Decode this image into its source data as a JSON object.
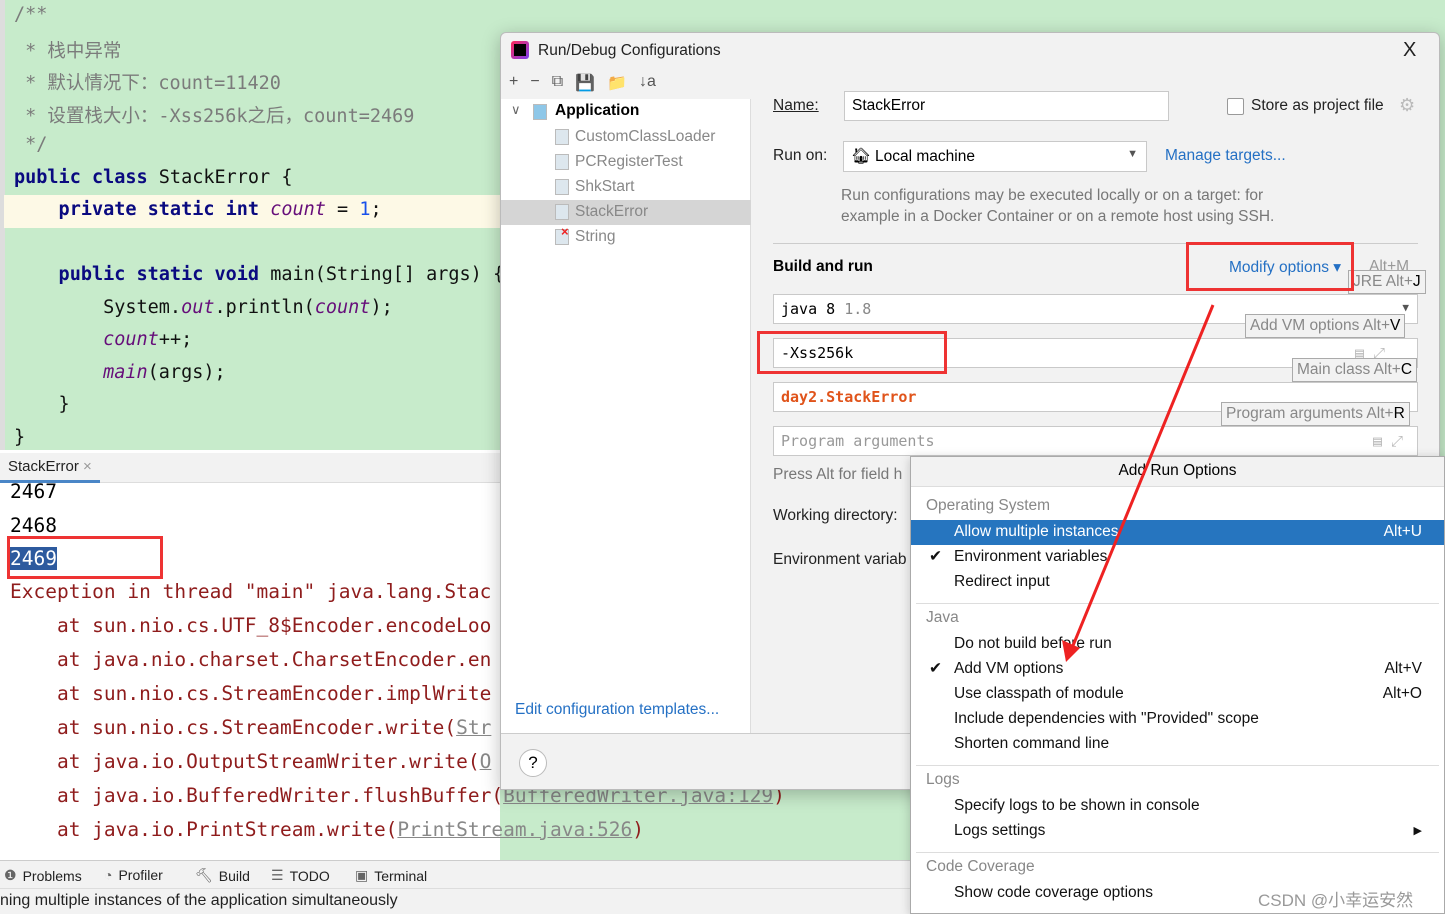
{
  "editor": {
    "lines": [
      {
        "parts": [
          {
            "t": "/**",
            "c": "cm"
          }
        ]
      },
      {
        "parts": [
          {
            "t": " * 栈中异常",
            "c": "cm"
          }
        ]
      },
      {
        "parts": [
          {
            "t": " * 默认情况下：count=11420",
            "c": "cm"
          }
        ]
      },
      {
        "parts": [
          {
            "t": " * 设置栈大小：-Xss256k之后，count=2469",
            "c": "cm"
          }
        ]
      },
      {
        "parts": [
          {
            "t": " */",
            "c": "cm"
          }
        ]
      },
      {
        "parts": [
          {
            "t": "public class ",
            "c": "kw"
          },
          {
            "t": "StackError {",
            "c": ""
          }
        ]
      },
      {
        "parts": [
          {
            "t": "    private static int ",
            "c": "kw"
          },
          {
            "t": "count",
            "c": "fld"
          },
          {
            "t": " = ",
            "c": ""
          },
          {
            "t": "1",
            "c": "num"
          },
          {
            "t": ";",
            "c": ""
          }
        ]
      },
      {
        "parts": []
      },
      {
        "parts": [
          {
            "t": "    public static void ",
            "c": "kw"
          },
          {
            "t": "main(String[] args) {",
            "c": ""
          }
        ]
      },
      {
        "parts": [
          {
            "t": "        System.",
            "c": ""
          },
          {
            "t": "out",
            "c": "fld"
          },
          {
            "t": ".println(",
            "c": ""
          },
          {
            "t": "count",
            "c": "fld"
          },
          {
            "t": ");",
            "c": ""
          }
        ]
      },
      {
        "parts": [
          {
            "t": "        ",
            "c": ""
          },
          {
            "t": "count",
            "c": "fld"
          },
          {
            "t": "++;",
            "c": ""
          }
        ]
      },
      {
        "parts": [
          {
            "t": "        ",
            "c": ""
          },
          {
            "t": "main",
            "c": "fld"
          },
          {
            "t": "(args);",
            "c": ""
          }
        ]
      },
      {
        "parts": [
          {
            "t": "    }",
            "c": ""
          }
        ]
      },
      {
        "parts": [
          {
            "t": "}",
            "c": ""
          }
        ]
      }
    ]
  },
  "run": {
    "tab": "StackError",
    "output": [
      "2467",
      "2468",
      "2469"
    ],
    "exception": "Exception in thread \"main\" java.lang.Stac",
    "trace": [
      {
        "text": "    at sun.nio.cs.UTF_8$Encoder.encodeLoo",
        "link": ""
      },
      {
        "text": "    at java.nio.charset.CharsetEncoder.en",
        "link": ""
      },
      {
        "text": "    at sun.nio.cs.StreamEncoder.implWrite",
        "link": ""
      },
      {
        "text": "    at sun.nio.cs.StreamEncoder.write(",
        "link": "Str"
      },
      {
        "text": "    at java.io.OutputStreamWriter.write(",
        "link": "O"
      },
      {
        "text": "    at java.io.BufferedWriter.flushBuffer(",
        "link": "BufferedWriter.java:129",
        "end": ")"
      },
      {
        "text": "    at java.io.PrintStream.write(",
        "link": "PrintStream.java:526",
        "end": ")"
      }
    ]
  },
  "bottom": {
    "tabs": [
      "Problems",
      "Profiler",
      "Build",
      "TODO",
      "Terminal"
    ],
    "status": "ning multiple instances of the application simultaneously"
  },
  "dialog": {
    "title": "Run/Debug Configurations",
    "close": "X",
    "toolbar": [
      "+",
      "−",
      "⧉",
      "💾",
      "📁",
      "↓a"
    ],
    "tree": {
      "group": "Application",
      "items": [
        "CustomClassLoader",
        "PCRegisterTest",
        "ShkStart",
        "StackError",
        "String"
      ]
    },
    "name_label": "Name:",
    "name_value": "StackError",
    "store_label": "Store as project file",
    "runon_label": "Run on:",
    "runon_value": "Local machine",
    "manage_targets": "Manage targets...",
    "hint": [
      "Run configurations may be executed locally or on a target: for",
      "example in a Docker Container or on a remote host using SSH."
    ],
    "build_run": "Build and run",
    "modify_options": "Modify options",
    "modify_shortcut": "Alt+M",
    "jre": "java 8",
    "jre_version": "1.8",
    "vm_options": "-Xss256k",
    "main_class": "day2.StackError",
    "program_args_placeholder": "Program arguments",
    "press_alt": "Press Alt for field h",
    "working_dir": "Working directory:",
    "env_vars": "Environment variab",
    "edit_templates": "Edit configuration templates...",
    "help": "?",
    "tips": [
      {
        "t": "JRE Alt+",
        "k": "J"
      },
      {
        "t": "Add VM options Alt+",
        "k": "V"
      },
      {
        "t": "Main class Alt+",
        "k": "C"
      },
      {
        "t": "Program arguments Alt+",
        "k": "R"
      }
    ]
  },
  "popup": {
    "title": "Add Run Options",
    "groups": [
      {
        "name": "Operating System",
        "items": [
          {
            "label": "Allow multiple instances",
            "shortcut": "Alt+U",
            "selected": true
          },
          {
            "label": "Environment variables",
            "checked": true
          },
          {
            "label": "Redirect input"
          }
        ]
      },
      {
        "name": "Java",
        "items": [
          {
            "label": "Do not build before run"
          },
          {
            "label": "Add VM options",
            "shortcut": "Alt+V",
            "checked": true
          },
          {
            "label": "Use classpath of module",
            "shortcut": "Alt+O"
          },
          {
            "label": "Include dependencies with \"Provided\" scope"
          },
          {
            "label": "Shorten command line"
          }
        ]
      },
      {
        "name": "Logs",
        "items": [
          {
            "label": "Specify logs to be shown in console"
          },
          {
            "label": "Logs settings",
            "submenu": true
          }
        ]
      },
      {
        "name": "Code Coverage",
        "items": [
          {
            "label": "Show code coverage options"
          }
        ]
      }
    ]
  },
  "watermark": "CSDN @小幸运安然",
  "colors": {
    "editor_bg": "#c7ebcb",
    "selection": "#2675bf",
    "annotation": "#ee3333",
    "link": "#2470c4"
  }
}
